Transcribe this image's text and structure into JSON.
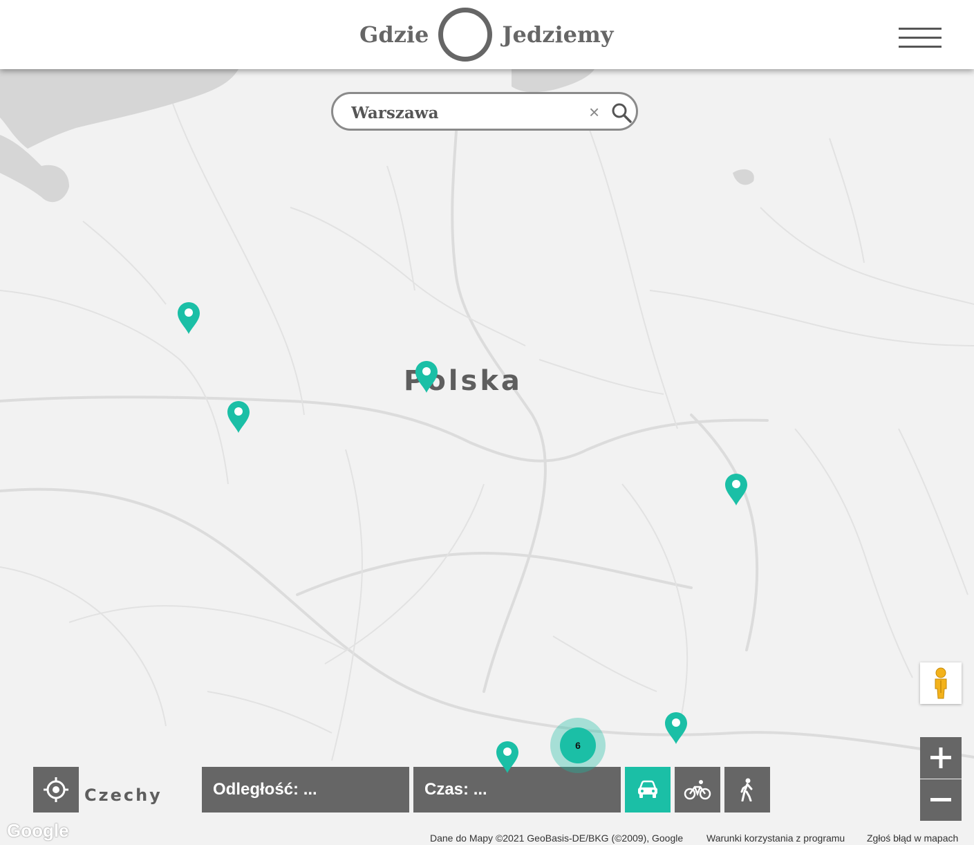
{
  "header": {
    "logo_left": "Gdzie",
    "logo_right": "Jedziemy",
    "menu_icon": "hamburger-menu-icon"
  },
  "search": {
    "value": "Warszawa",
    "clear_glyph": "×",
    "search_icon": "magnifier-icon"
  },
  "map": {
    "country_label": "Polska",
    "neighbor_label": "Czechy",
    "cluster_count": "6",
    "pin_color": "#1bbfa6",
    "pin_icon": "map-pin-icon",
    "pin_count": 7
  },
  "controls": {
    "locate_icon": "crosshair-icon",
    "distance_label": "Odległość: ...",
    "time_label": "Czas: ...",
    "modes": [
      {
        "name": "car",
        "icon": "car-icon",
        "active": true
      },
      {
        "name": "bike",
        "icon": "bicycle-icon",
        "active": false
      },
      {
        "name": "walk",
        "icon": "pedestrian-icon",
        "active": false
      }
    ],
    "zoom_in_glyph": "+",
    "zoom_out_glyph": "−",
    "pegman_icon": "pegman-icon"
  },
  "attribution": {
    "google_logo": "Google",
    "data": "Dane do Mapy ©2021 GeoBasis-DE/BKG (©2009), Google",
    "terms": "Warunki korzystania z programu",
    "report": "Zgłoś błąd w mapach"
  },
  "colors": {
    "accent": "#1bbfa6",
    "control_gray": "#666666",
    "map_bg": "#f2f2f2",
    "water": "#d6d6d6"
  }
}
